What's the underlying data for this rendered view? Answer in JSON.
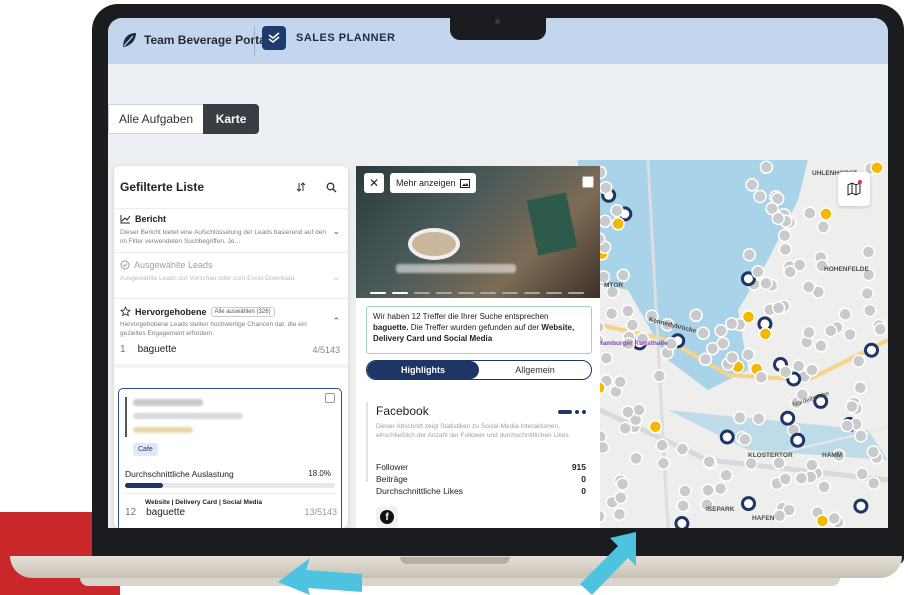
{
  "header": {
    "brand": "Team Beverage Portal",
    "product": "SALES PLANNER"
  },
  "tabs": [
    {
      "label": "Alle Aufgaben",
      "active": false
    },
    {
      "label": "Karte",
      "active": true
    }
  ],
  "left_panel": {
    "title": "Gefilterte Liste",
    "sections": [
      {
        "title": "Bericht",
        "icon": "chart-line-icon",
        "description": "Dieser Bericht bietet eine Aufschlüsselung der Leads basierend auf den im Filter verwendeten Suchbegriffen. Je…"
      },
      {
        "title": "Ausgewählte Leads",
        "icon": "check-circle-icon",
        "description": "Ausgewählte Leads zur Vorschau oder zum Excel-Download."
      },
      {
        "title": "Hervorgehobene",
        "icon": "star-icon",
        "badge": "Alle auswählen (326)",
        "description": "Hervorgehobene Leads stellen hochwertige Chancen dar, die ein gezieltes Engagement erfordern."
      }
    ],
    "term_row": {
      "index": "1",
      "term": "baguette",
      "count": "4/5143"
    },
    "card": {
      "tag": "Cafe",
      "utilization_label": "Durchschnittliche Auslastung",
      "utilization_value": "18.0%",
      "utilization_fraction": 0.18,
      "sources": "Website | Delivery Card | Social Media",
      "index": "12",
      "term": "baguette",
      "count": "13/5143"
    }
  },
  "detail_panel": {
    "more_label": "Mehr anzeigen",
    "info_prefix": "Wir haben 12 Treffer die Ihrer Suche entsprechen",
    "info_term": "baguette.",
    "info_middle": "Die Treffer wurden gefunden auf der",
    "info_sources": "Website, Delivery Card und Social Media",
    "segments": [
      "Highlights",
      "Allgemein"
    ],
    "facebook": {
      "title": "Facebook",
      "description": "Dieser Abschnitt zeigt Statistiken zu Social-Media-Interaktionen, einschließlich der Anzahl der Follower und durchschnittlichen Likes.",
      "stats": [
        {
          "label": "Follower",
          "value": "915"
        },
        {
          "label": "Beiträge",
          "value": "0"
        },
        {
          "label": "Durchschnittliche Likes",
          "value": "0"
        }
      ]
    }
  },
  "map": {
    "labels": [
      "UHLENHORST",
      "HOHENFELDE",
      "MTOR",
      "Kennedybrücke",
      "Hamburger Kunsthalle",
      "KLOSTERTOR",
      "HAMM",
      "ISEPARK",
      "HAFEN",
      "Nordelbische"
    ]
  },
  "colors": {
    "header_bg": "#c4d6ee",
    "accent": "#1e3566",
    "map_water": "#a9d3e8",
    "marker_dark": "#1e3566",
    "marker_gold": "#f2b900",
    "marker_grey": "#c9cacc"
  }
}
